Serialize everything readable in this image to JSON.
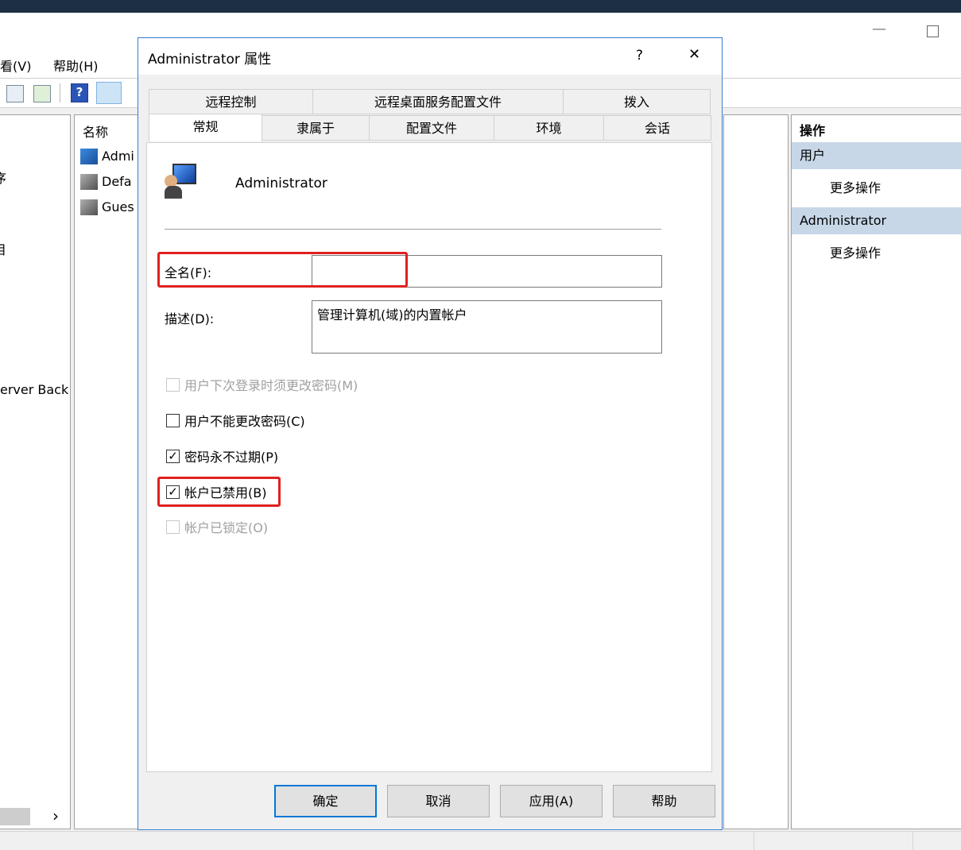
{
  "mmc": {
    "menu": {
      "view": "看(V)",
      "help": "帮助(H)"
    },
    "left_pane": {
      "items": [
        "序",
        "目",
        "erver Back"
      ]
    },
    "list_pane": {
      "header": "名称",
      "items": [
        "Admi",
        "Defa",
        "Gues"
      ]
    },
    "actions": {
      "header": "操作",
      "groups": [
        {
          "title": "用户",
          "item": "更多操作"
        },
        {
          "title": "Administrator",
          "item": "更多操作"
        }
      ]
    },
    "scroll_right": "›"
  },
  "dialog": {
    "title": "Administrator 属性",
    "help_glyph": "?",
    "close_glyph": "✕",
    "tabs_row1": [
      "远程控制",
      "远程桌面服务配置文件",
      "拨入"
    ],
    "tabs_row2": [
      "常规",
      "隶属于",
      "配置文件",
      "环境",
      "会话"
    ],
    "active_tab": "常规",
    "user_name": "Administrator",
    "fields": {
      "fullname_label": "全名(F):",
      "fullname_value": "",
      "description_label": "描述(D):",
      "description_value": "管理计算机(域)的内置帐户"
    },
    "checkboxes": [
      {
        "label": "用户下次登录时须更改密码(M)",
        "checked": false,
        "enabled": false
      },
      {
        "label": "用户不能更改密码(C)",
        "checked": false,
        "enabled": true
      },
      {
        "label": "密码永不过期(P)",
        "checked": true,
        "enabled": true
      },
      {
        "label": "帐户已禁用(B)",
        "checked": true,
        "enabled": true
      },
      {
        "label": "帐户已锁定(O)",
        "checked": false,
        "enabled": false
      }
    ],
    "buttons": {
      "ok": "确定",
      "cancel": "取消",
      "apply": "应用(A)",
      "help": "帮助"
    }
  },
  "colors": {
    "highlight": "#e02020",
    "accent": "#0078d7",
    "action_header": "#c7d7e8"
  }
}
